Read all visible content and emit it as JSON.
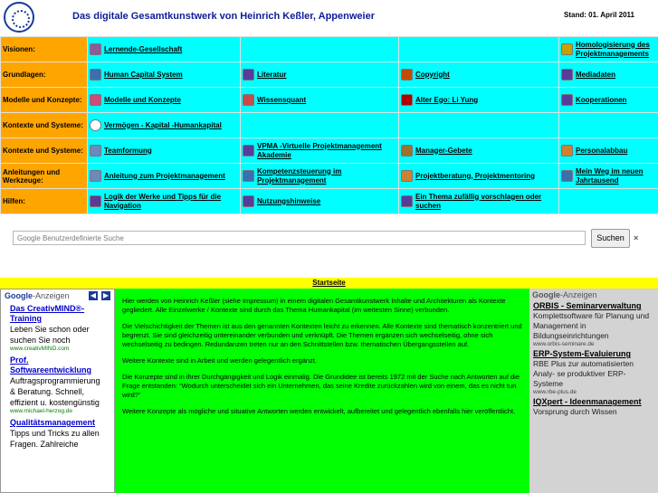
{
  "header": {
    "title": "Das digitale Gesamtkunstwerk von Heinrich Keßler, Appenweier",
    "stand": "Stand: 01. April 2011",
    "logo": "round-seal-logo"
  },
  "nav_rows": [
    {
      "category": "Visionen:",
      "cells": [
        {
          "label": "Lernende-Gesellschaft",
          "icon": "people-icon",
          "color": "#8b5a9f"
        },
        {
          "label": "",
          "icon": "",
          "color": ""
        },
        {
          "label": "",
          "icon": "",
          "color": ""
        },
        {
          "label": "Homologisierung des Projektmanagements",
          "icon": "ring-icon",
          "color": "#c8a000"
        },
        {
          "label": "",
          "icon": "",
          "color": ""
        }
      ]
    },
    {
      "category": "Grundlagen:",
      "cells": [
        {
          "label": "Human Capital System",
          "icon": "monitor-icon",
          "color": "#3a6fb0"
        },
        {
          "label": "Literatur",
          "icon": "pen-icon",
          "color": "#5a3a9a"
        },
        {
          "label": "Copyright",
          "icon": "copyright-icon",
          "color": "#c84a00"
        },
        {
          "label": "Mediadaten",
          "icon": "pen-icon",
          "color": "#5a3a9a"
        },
        {
          "label": "",
          "icon": "",
          "color": ""
        }
      ]
    },
    {
      "category": "Modelle und Konzepte:",
      "cells": [
        {
          "label": "Modelle und Konzepte",
          "icon": "diagram-icon",
          "color": "#d04a7a"
        },
        {
          "label": "Wissensquant",
          "icon": "chart-icon",
          "color": "#c84a4a"
        },
        {
          "label": "Alter Ego: Li Yung",
          "icon": "character-icon",
          "color": "#b00000"
        },
        {
          "label": "Kooperationen",
          "icon": "pen-icon",
          "color": "#5a3a9a"
        },
        {
          "label": "",
          "icon": "",
          "color": ""
        }
      ]
    },
    {
      "category": "Kontexte und Systeme:",
      "cells": [
        {
          "label": "Vermögen - Kapital -Humankapital",
          "icon": "circle-icon",
          "color": "#ffffff"
        },
        {
          "label": "",
          "icon": "",
          "color": ""
        },
        {
          "label": "",
          "icon": "",
          "color": ""
        },
        {
          "label": "",
          "icon": "",
          "color": ""
        },
        {
          "label": "",
          "icon": "",
          "color": ""
        }
      ]
    },
    {
      "category": "Kontexte und Systeme:",
      "cells": [
        {
          "label": "Teamformung",
          "icon": "list-icon",
          "color": "#6a8ac0"
        },
        {
          "label": "VPMA -Virtuelle Projektmanagement Akademie",
          "icon": "pen-icon",
          "color": "#5a3a9a"
        },
        {
          "label": "Manager-Gebete",
          "icon": "image-icon",
          "color": "#a07030"
        },
        {
          "label": "Personalabbau",
          "icon": "document-icon",
          "color": "#d08030"
        },
        {
          "label": "",
          "icon": "",
          "color": ""
        }
      ]
    },
    {
      "category": "Anleitungen und Werkzeuge:",
      "cells": [
        {
          "label": "Anleitung zum Projektmanagement",
          "icon": "list-icon",
          "color": "#6a8ac0"
        },
        {
          "label": "Kompetenzsteuerung im Projektmanagement",
          "icon": "monitor-icon",
          "color": "#3a6fb0"
        },
        {
          "label": "Projektberatung, Projektmentoring",
          "icon": "document-icon",
          "color": "#d08030"
        },
        {
          "label": "Mein Weg im neuen Jahrtausend",
          "icon": "mail-icon",
          "color": "#3a6fb0"
        },
        {
          "label": "",
          "icon": "",
          "color": ""
        }
      ]
    },
    {
      "category": "Hilfen:",
      "cells": [
        {
          "label": "Logik der Werke und Tipps für die Navigation",
          "icon": "pen-icon",
          "color": "#5a3a9a"
        },
        {
          "label": "Nutzungshinweise",
          "icon": "pen-icon",
          "color": "#5a3a9a"
        },
        {
          "label": "Ein Thema zufällig vorschlagen oder suchen",
          "icon": "pen-icon",
          "color": "#5a3a9a"
        },
        {
          "label": "",
          "icon": "",
          "color": ""
        },
        {
          "label": "",
          "icon": "",
          "color": ""
        }
      ]
    }
  ],
  "search": {
    "placeholder": "Benutzerdefinierte Suche",
    "brand": "Google",
    "button": "Suchen",
    "clear": "×"
  },
  "startseite": "Startseite",
  "left_ads": {
    "header_brand": "Google",
    "header_label": "-Anzeigen",
    "items": [
      {
        "title": "Das CreativMIND®-Training",
        "desc": "Leben Sie schon oder suchen Sie noch",
        "url": "www.creativMIND.com"
      },
      {
        "title": "Prof. Softwareentwicklung",
        "desc": "Auftragsprogrammierung & Beratung. Schnell, effizient u. kostengünstig",
        "url": "www.michael-herzog.de"
      },
      {
        "title": "Qualitätsmanagement",
        "desc": "Tipps und Tricks zu allen Fragen. Zahlreiche",
        "url": ""
      }
    ]
  },
  "right_ads": {
    "header_brand": "Google",
    "header_label": "-Anzeigen",
    "items": [
      {
        "title": "ORBIS - Seminarverwaltung",
        "desc": "Komplettsoftware für Planung und Management in Bildungseinrichtungen",
        "url": "www.orbis-seminare.de"
      },
      {
        "title": "ERP-System-Evaluierung",
        "desc": "RBE Plus zur automatisierten Analy- se produktiver ERP-Systeme",
        "url": "www.rbe-plus.de"
      },
      {
        "title": "IQXpert - Ideenmanagement",
        "desc": "Vorsprung durch Wissen",
        "url": ""
      }
    ]
  },
  "main": {
    "paragraphs": [
      "Hier werden von Heinrich Keßler (siehe Impressum) in einem digitalen Gesamtkunstwerk Inhalte und Architekturen als Kontexte gegliedert. Alle Einzelwerke / Kontexte sind durch das Thema Humankapital (im weitesten Sinne) verbunden.",
      "Die Vielschichtigkeit der Themen ist aus den genannten Kontexten leicht zu erkennen. Alle Kontexte sind thematisch konzentriert und begrenzt. Sie sind gleichzeitig untereinander verbunden und verknüpft. Die Themen ergänzen sich wechselseitig, ohne sich wechselseitig zu bedingen. Redundanzen treten nur an den Schnittstellen bzw. thematischen Übergangsstellen auf.",
      "Weitere Kontexte sind in Arbeit und werden gelegentlich ergänzt.",
      "Die Konzepte sind in ihrer Durchgängigkeit und Logik einmalig. Die Grundidee ist bereits 1972 mit der Suche nach Antworten auf die Frage entstanden: \"Wodurch unterscheidet sich ein Unternehmen, das seine Kredite zurückzahlen wird von einem, das es nicht tun wird?\"",
      "Weitere Konzepte als mögliche und situative Antworten werden entwickelt, aufbereitet und gelegentlich ebenfalls hier veröffentlicht."
    ]
  },
  "colors": {
    "title_blue": "#0d1d99",
    "category_orange": "#ffa500",
    "cell_cyan": "#00ffff",
    "start_yellow": "#ffff00",
    "main_green": "#00ff00"
  }
}
